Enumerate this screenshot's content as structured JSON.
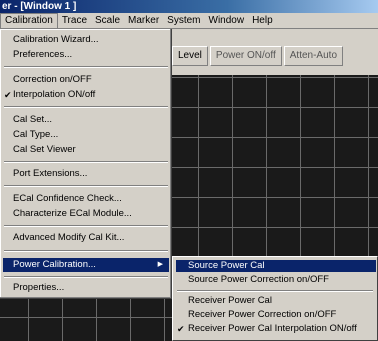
{
  "window": {
    "title": "er - [Window 1 ]"
  },
  "menubar": {
    "items": [
      {
        "label": "Calibration",
        "ul": "",
        "rest": ""
      },
      {
        "label": "Trace"
      },
      {
        "label": "Scale"
      },
      {
        "label": "Marker"
      },
      {
        "label": "System"
      },
      {
        "label": "Window"
      },
      {
        "label": "Help"
      }
    ]
  },
  "toolbar": {
    "buttons": [
      "Level",
      "Power ON/off",
      "Atten-Auto"
    ]
  },
  "calibration_menu": {
    "items": [
      "Calibration Wizard...",
      "Preferences...",
      "Correction on/OFF",
      "Interpolation ON/off",
      "Cal Set...",
      "Cal Type...",
      "Cal Set Viewer",
      "Port Extensions...",
      "ECal Confidence Check...",
      "Characterize ECal Module...",
      "Advanced Modify Cal Kit...",
      "Power Calibration...",
      "Properties..."
    ],
    "checked_item": "Interpolation ON/off",
    "highlighted_item": "Power Calibration..."
  },
  "power_submenu": {
    "items": [
      "Source Power Cal",
      "Source Power Correction on/OFF",
      "Receiver Power Cal",
      "Receiver Power Correction on/OFF",
      "Receiver Power Cal Interpolation ON/off"
    ],
    "highlighted_item": "Source Power Cal",
    "checked_item": "Receiver Power Cal Interpolation ON/off"
  },
  "glyphs": {
    "check": "✔",
    "arrow": "▶"
  }
}
